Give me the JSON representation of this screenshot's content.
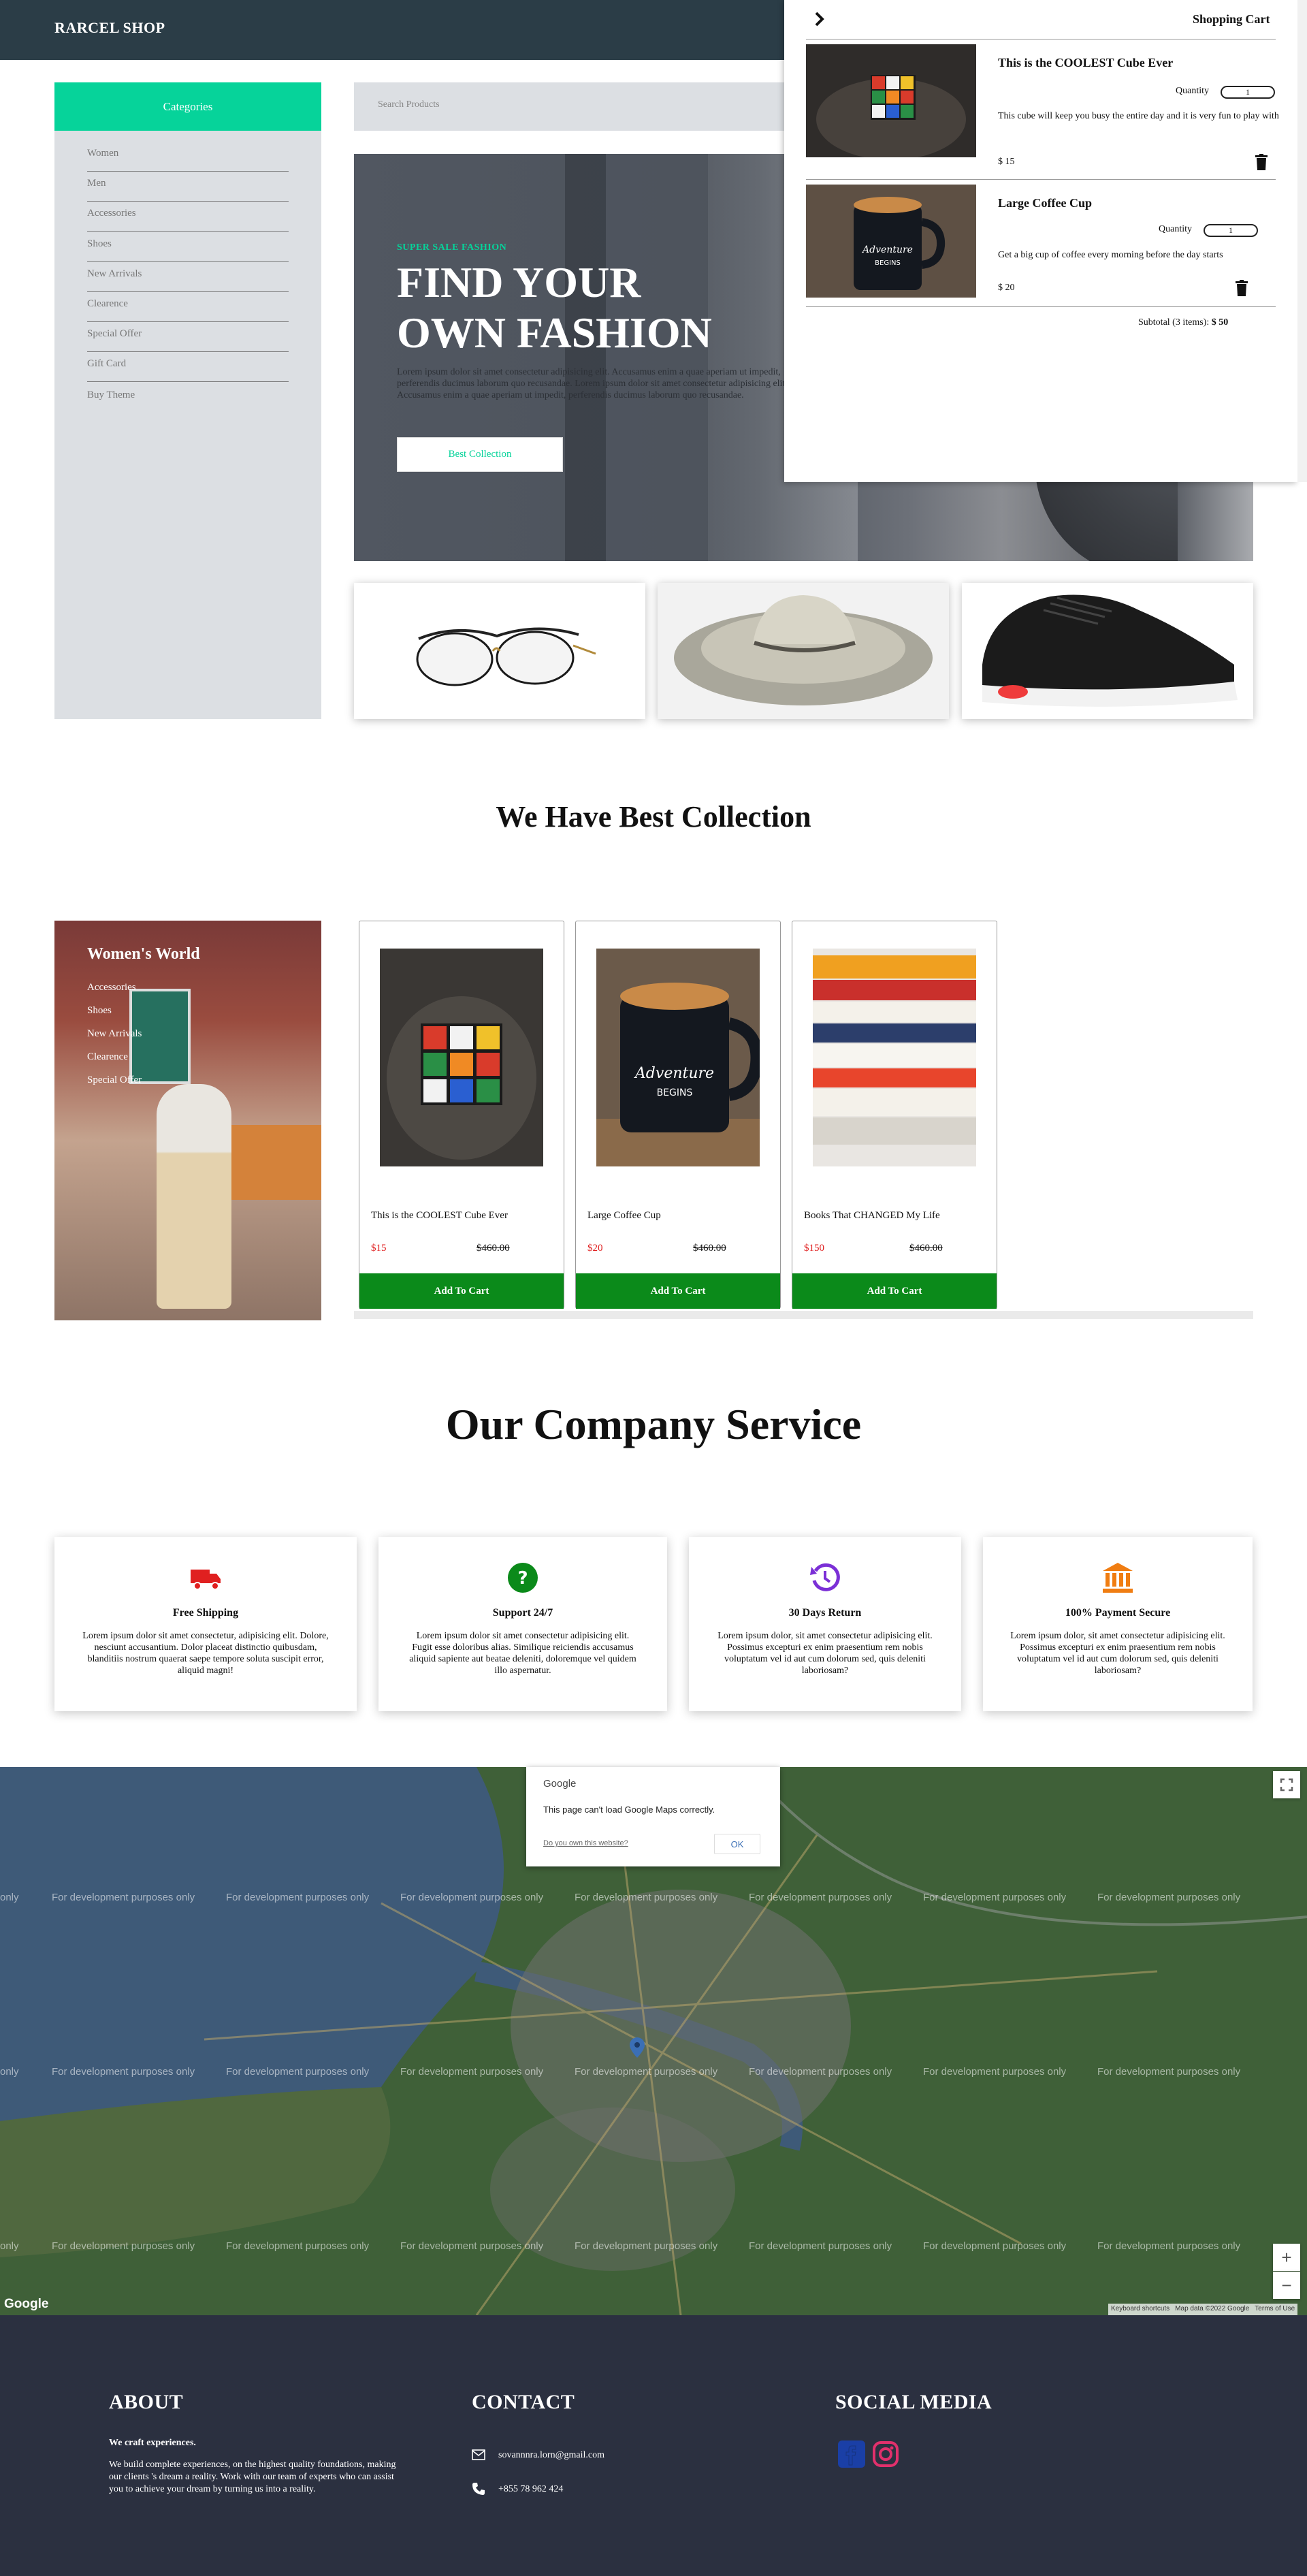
{
  "brand": "RARCEL SHOP",
  "sidebar": {
    "heading": "Categories",
    "items": [
      "Women",
      "Men",
      "Accessories",
      "Shoes",
      "New Arrivals",
      "Clearence",
      "Special Offer",
      "Gift Card",
      "Buy Theme"
    ]
  },
  "search": {
    "placeholder": "Search Products"
  },
  "hero": {
    "subtitle": "SUPER SALE FASHION",
    "title_line1": "FIND YOUR",
    "title_line2": "OWN FASHION",
    "description": "Lorem ipsum dolor sit amet consectetur adipisicing elit. Accusamus enim a quae aperiam ut impedit, perferendis ducimus laborum quo recusandae. Lorem ipsum dolor sit amet consectetur adipisicing elit. Accusamus enim a quae aperiam ut impedit, perferendis ducimus laborum quo recusandae.",
    "button": "Best Collection"
  },
  "tiles": [
    "glasses",
    "hat",
    "sneaker"
  ],
  "collection_heading": "We Have Best Collection",
  "womens_world": {
    "title": "Women's World",
    "links": [
      "Accessories",
      "Shoes",
      "New Arrivals",
      "Clearence",
      "Special Offer"
    ]
  },
  "products": [
    {
      "name": "This is the COOLEST Cube Ever",
      "price": "$15",
      "old_price": "$460.00",
      "button": "Add To Cart"
    },
    {
      "name": "Large Coffee Cup",
      "price": "$20",
      "old_price": "$460.00",
      "button": "Add To Cart"
    },
    {
      "name": "Books That CHANGED My Life",
      "price": "$150",
      "old_price": "$460.00",
      "button": "Add To Cart"
    }
  ],
  "service_heading": "Our Company Service",
  "services": [
    {
      "icon": "truck-icon",
      "color": "#e02020",
      "title": "Free Shipping",
      "text": "Lorem ipsum dolor sit amet consectetur, adipisicing elit. Dolore, nesciunt accusantium. Dolor placeat distinctio quibusdam, blanditiis nostrum quaerat saepe tempore soluta suscipit error, aliquid magni!"
    },
    {
      "icon": "question-circle-icon",
      "color": "#0b8a1a",
      "title": "Support 24/7",
      "text": "Lorem ipsum dolor sit amet consectetur adipisicing elit. Fugit esse doloribus alias. Similique reiciendis accusamus aliquid sapiente aut beatae deleniti, doloremque vel quidem illo aspernatur."
    },
    {
      "icon": "history-icon",
      "color": "#7b2fd6",
      "title": "30 Days Return",
      "text": "Lorem ipsum dolor, sit amet consectetur adipisicing elit. Possimus excepturi ex enim praesentium rem nobis voluptatum vel id aut cum dolorum sed, quis deleniti laboriosam?"
    },
    {
      "icon": "bank-icon",
      "color": "#f07d12",
      "title": "100% Payment Secure",
      "text": "Lorem ipsum dolor, sit amet consectetur adipisicing elit. Possimus excepturi ex enim praesentium rem nobis voluptatum vel id aut cum dolorum sed, quis deleniti laboriosam?"
    }
  ],
  "map": {
    "watermark": "For development purposes only",
    "watermark_partial": "only",
    "dialog_brand": "Google",
    "dialog_message": "This page can't load Google Maps correctly.",
    "dialog_link": "Do you own this website?",
    "dialog_ok": "OK",
    "logo": "Google",
    "attribution": [
      "Keyboard shortcuts",
      "Map data ©2022 Google",
      "Terms of Use"
    ],
    "zoom_in": "+",
    "zoom_out": "−"
  },
  "footer": {
    "about_heading": "ABOUT",
    "about_tagline": "We craft experiences.",
    "about_text": "We build complete experiences, on the highest quality foundations, making our clients 's dream a reality. Work with our team of experts who can assist you to achieve your dream by turning us into a reality.",
    "contact_heading": "CONTACT",
    "email": "sovannnra.lorn@gmail.com",
    "phone": "+855 78 962 424",
    "social_heading": "SOCIAL MEDIA",
    "facebook_color": "#1a3fa6",
    "instagram_color": "#e1306c"
  },
  "cart": {
    "title": "Shopping Cart",
    "quantity_label": "Quantity",
    "items": [
      {
        "name": "This is the COOLEST Cube Ever",
        "quantity": "1",
        "description": "This cube will keep you busy the entire day and it is very fun to play with",
        "price": "$ 15"
      },
      {
        "name": "Large Coffee Cup",
        "quantity": "1",
        "description": "Get a big cup of coffee every morning before the day starts",
        "price": "$ 20"
      }
    ],
    "subtotal_label": "Subtotal (3 items):",
    "subtotal_value": "$ 50"
  },
  "colors": {
    "accent": "#06d39a",
    "header": "#2b3d47",
    "footer": "#2b3040",
    "button": "#0b8a1a",
    "price": "#e02020"
  }
}
